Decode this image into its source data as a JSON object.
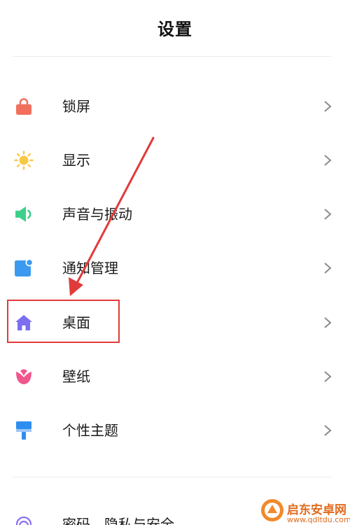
{
  "header": {
    "title": "设置"
  },
  "menu": {
    "items": [
      {
        "label": "锁屏",
        "icon": "lock-icon",
        "color": "#f1705c"
      },
      {
        "label": "显示",
        "icon": "sun-icon",
        "color": "#f7c843"
      },
      {
        "label": "声音与振动",
        "icon": "speaker-icon",
        "color": "#3ed08a"
      },
      {
        "label": "通知管理",
        "icon": "notification-icon",
        "color": "#3b9af0"
      },
      {
        "label": "桌面",
        "icon": "home-icon",
        "color": "#7b6ff0"
      },
      {
        "label": "壁纸",
        "icon": "tulip-icon",
        "color": "#f0558c"
      },
      {
        "label": "个性主题",
        "icon": "brush-icon",
        "color": "#2e8ef0"
      },
      {
        "label": "密码、隐私与安全",
        "icon": "fingerprint-icon",
        "color": "#8a6ff0"
      }
    ]
  },
  "annotation": {
    "highlight_color": "#e23a3a"
  },
  "watermark": {
    "name": "启东安卓网",
    "url": "www.qdltdu.com"
  }
}
